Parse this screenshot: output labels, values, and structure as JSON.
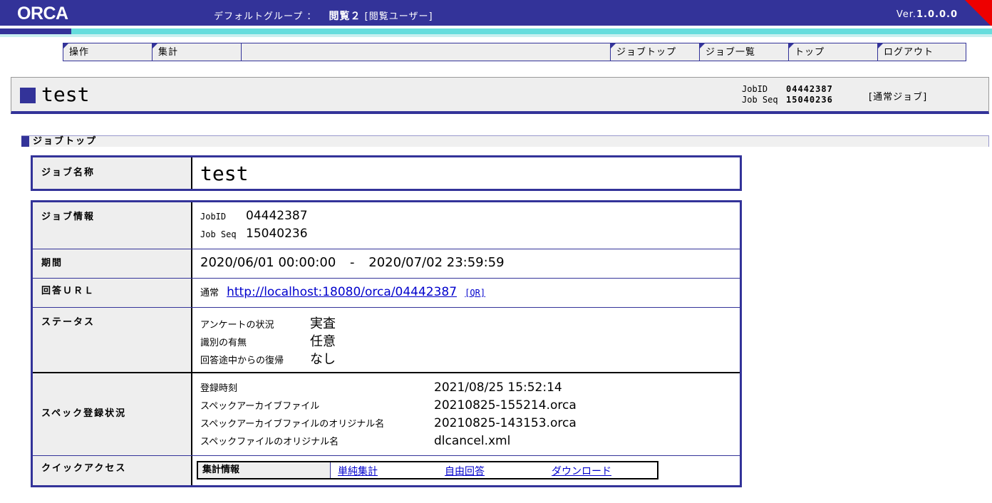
{
  "header": {
    "logo": "ORCA",
    "group_label": "デフォルトグループ ：",
    "user_name": "閲覧２",
    "user_role": "[閲覧ユーザー]",
    "version_prefix": "Ver.",
    "version_number": "1.0.0.0"
  },
  "menu": {
    "left": [
      "操作",
      "集計"
    ],
    "right": [
      "ジョブトップ",
      "ジョブ一覧",
      "トップ",
      "ログアウト"
    ]
  },
  "title": {
    "job_name": "test",
    "jobid_label": "JobID",
    "jobid_value": "04442387",
    "jobseq_label": "Job Seq",
    "jobseq_value": "15040236",
    "job_type": "[通常ジョブ]"
  },
  "section": {
    "label": "ジョブトップ"
  },
  "job_name_row": {
    "label": "ジョブ名称",
    "value": "test"
  },
  "job_info": {
    "label": "ジョブ情報",
    "jobid_label": "JobID",
    "jobid_value": "04442387",
    "jobseq_label": "Job Seq",
    "jobseq_value": "15040236"
  },
  "period": {
    "label": "期間",
    "start": "2020/06/01 00:00:00",
    "separator": "-",
    "end": "2020/07/02 23:59:59"
  },
  "answer_url": {
    "label": "回答ＵＲＬ",
    "type_label": "通常",
    "url": "http://localhost:18080/orca/04442387",
    "qr_label": "[QR]"
  },
  "status": {
    "label": "ステータス",
    "items": [
      {
        "key": "アンケートの状況",
        "value": "実査"
      },
      {
        "key": "識別の有無",
        "value": "任意"
      },
      {
        "key": "回答途中からの復帰",
        "value": "なし"
      }
    ]
  },
  "spec": {
    "label": "スペック登録状況",
    "items": [
      {
        "key": "登録時刻",
        "value": "2021/08/25 15:52:14"
      },
      {
        "key": "スペックアーカイブファイル",
        "value": "20210825-155214.orca"
      },
      {
        "key": "スペックアーカイブファイルのオリジナル名",
        "value": "20210825-143153.orca"
      },
      {
        "key": "スペックファイルのオリジナル名",
        "value": "dlcancel.xml"
      }
    ]
  },
  "quick_access": {
    "label": "クイックアクセス",
    "box_label": "集計情報",
    "links": [
      "単純集計",
      "自由回答",
      "ダウンロード"
    ]
  }
}
